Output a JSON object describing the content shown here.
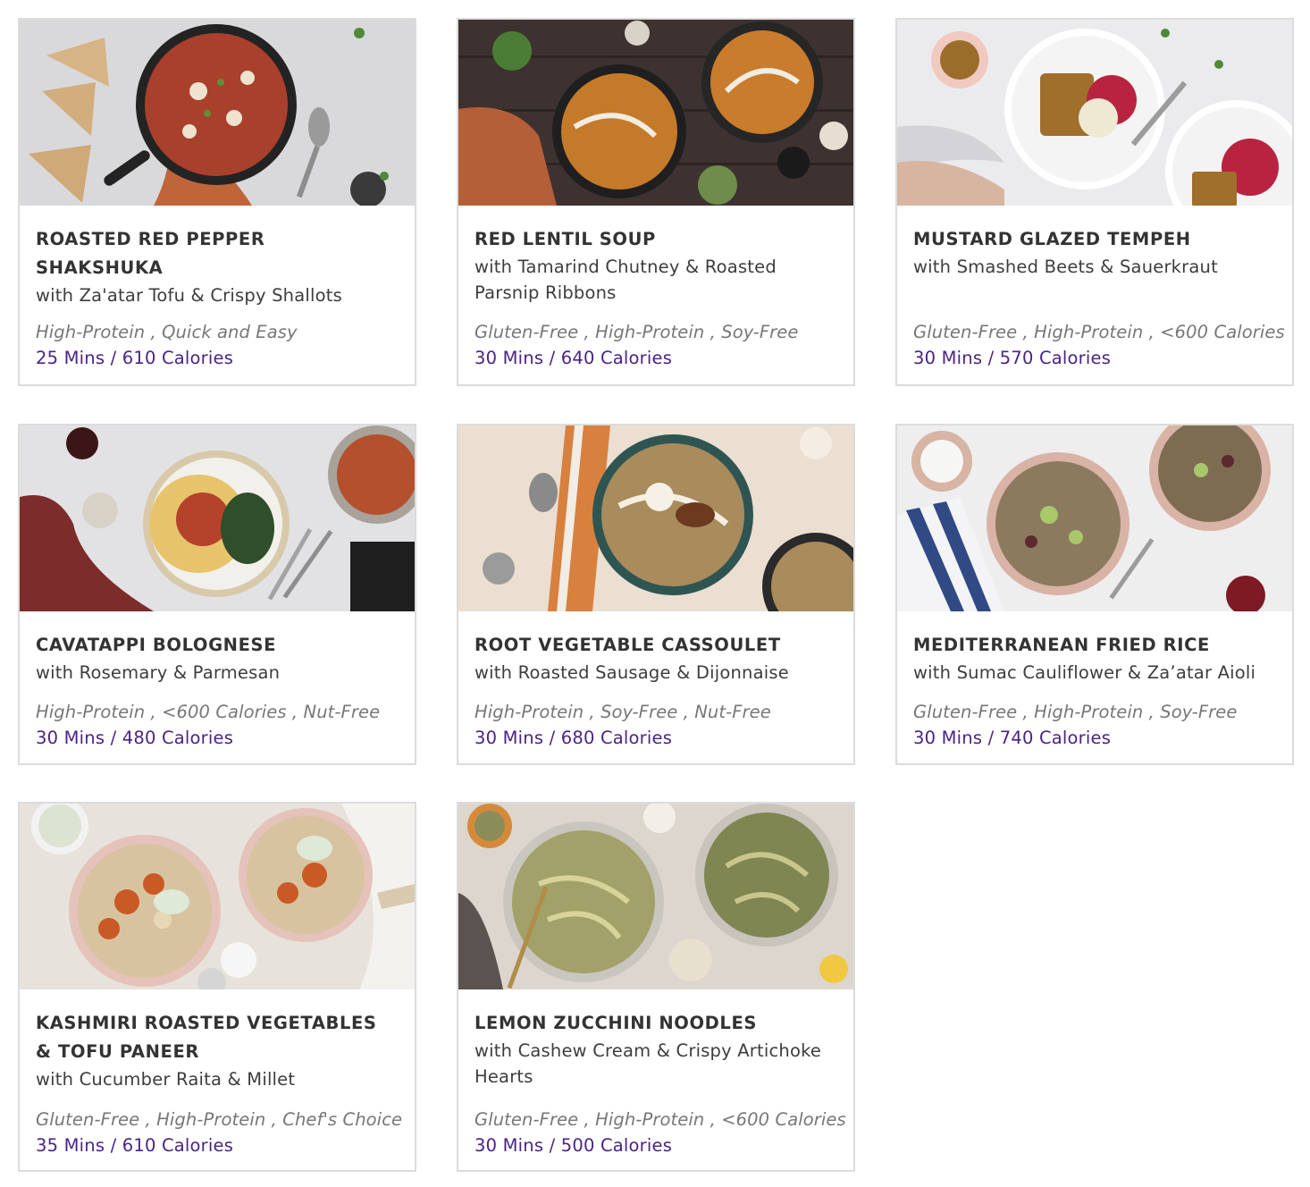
{
  "colors": {
    "accent": "#4b2386",
    "tag": "#777777",
    "border": "#dcdcdc"
  },
  "recipes": [
    {
      "title": "ROASTED RED PEPPER SHAKSHUKA",
      "subtitle": "with Za'atar Tofu & Crispy Shallots",
      "tags": "High-Protein , Quick and Easy",
      "time": "25 Mins / 610 Calories",
      "image_icon": "skillet-shakshuka-photo"
    },
    {
      "title": "RED LENTIL SOUP",
      "subtitle": "with Tamarind Chutney & Roasted Parsnip Ribbons",
      "tags": "Gluten-Free , High-Protein , Soy-Free",
      "time": "30 Mins / 640 Calories",
      "image_icon": "lentil-soup-bowls-photo"
    },
    {
      "title": "MUSTARD GLAZED TEMPEH",
      "subtitle": "with Smashed Beets & Sauerkraut",
      "tags": "Gluten-Free , High-Protein , <600 Calories",
      "time": "30 Mins / 570 Calories",
      "image_icon": "tempeh-plates-photo"
    },
    {
      "title": "CAVATAPPI BOLOGNESE",
      "subtitle": "with Rosemary & Parmesan",
      "tags": "High-Protein , <600 Calories , Nut-Free",
      "time": "30 Mins / 480 Calories",
      "image_icon": "pasta-plate-photo"
    },
    {
      "title": "ROOT VEGETABLE CASSOULET",
      "subtitle": "with Roasted Sausage & Dijonnaise",
      "tags": "High-Protein , Soy-Free , Nut-Free",
      "time": "30 Mins / 680 Calories",
      "image_icon": "cassoulet-bowls-photo"
    },
    {
      "title": "MEDITERRANEAN FRIED RICE",
      "subtitle": "with Sumac Cauliflower & Za’atar Aioli",
      "tags": "Gluten-Free , High-Protein , Soy-Free",
      "time": "30 Mins / 740 Calories",
      "image_icon": "fried-rice-bowls-photo"
    },
    {
      "title": "KASHMIRI ROASTED VEGETABLES & TOFU PANEER",
      "subtitle": "with Cucumber Raita & Millet",
      "tags": "Gluten-Free , High-Protein , Chef's Choice",
      "time": "35 Mins / 610 Calories",
      "image_icon": "roasted-vegetable-bowls-photo"
    },
    {
      "title": "LEMON ZUCCHINI NOODLES",
      "subtitle": "with Cashew Cream & Crispy Artichoke Hearts",
      "tags": "Gluten-Free , High-Protein , <600 Calories",
      "time": "30 Mins / 500 Calories",
      "image_icon": "zucchini-noodle-bowls-photo"
    }
  ]
}
